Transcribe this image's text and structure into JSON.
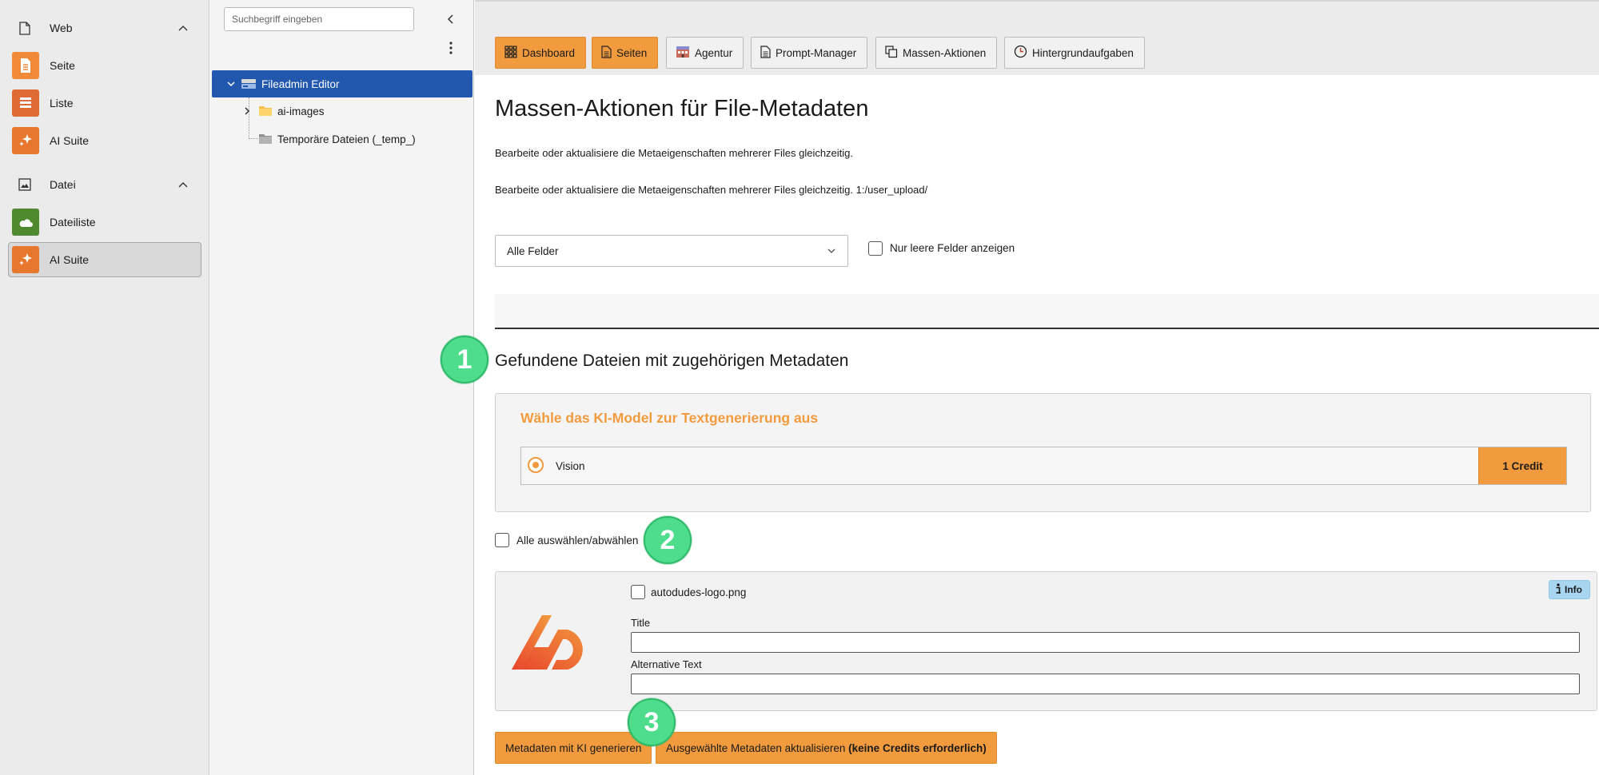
{
  "module_menu": {
    "groups": [
      {
        "label": "Web",
        "icon": "page-icon",
        "items": [
          {
            "label": "Seite",
            "icon": "page-icon",
            "color": "#f08a38"
          },
          {
            "label": "Liste",
            "icon": "list-icon",
            "color": "#e06a33"
          },
          {
            "label": "AI Suite",
            "icon": "sparkle-icon",
            "color": "#e8772e"
          }
        ]
      },
      {
        "label": "Datei",
        "icon": "image-icon",
        "items": [
          {
            "label": "Dateiliste",
            "icon": "cloud-file-icon",
            "color": "#4f8a2f"
          },
          {
            "label": "AI Suite",
            "icon": "sparkle-icon",
            "color": "#e8772e",
            "active": true
          }
        ]
      }
    ]
  },
  "tree": {
    "search_placeholder": "Suchbegriff eingeben",
    "root": {
      "label": "Fileadmin Editor",
      "icon": "storage-icon"
    },
    "children": [
      {
        "label": "ai-images",
        "icon": "folder-icon"
      },
      {
        "label": "Temporäre Dateien (_temp_)",
        "icon": "folder-grey-icon"
      }
    ]
  },
  "toolbar": {
    "buttons": [
      {
        "label": "Dashboard",
        "icon": "grid-icon",
        "active": true
      },
      {
        "label": "Seiten",
        "icon": "document-icon",
        "active": true
      },
      {
        "label": "Agentur",
        "icon": "building-icon",
        "active": false
      },
      {
        "label": "Prompt-Manager",
        "icon": "document-icon",
        "active": false
      },
      {
        "label": "Massen-Aktionen",
        "icon": "copy-icon",
        "active": false
      },
      {
        "label": "Hintergrundaufgaben",
        "icon": "clock-icon",
        "active": false
      }
    ]
  },
  "main": {
    "title": "Massen-Aktionen für File-Metadaten",
    "description_1": "Bearbeite oder aktualisiere die Metaeigenschaften mehrerer Files gleichzeitig.",
    "description_2": "Bearbeite oder aktualisiere die Metaeigenschaften mehrerer Files gleichzeitig. 1:/user_upload/",
    "field_select_value": "Alle Felder",
    "only_empty_label": "Nur leere Felder anzeigen",
    "found_title": "Gefundene Dateien mit zugehörigen Metadaten",
    "model_heading": "Wähle das KI-Model zur Textgenerierung aus",
    "model": {
      "name": "Vision",
      "credit": "1 Credit",
      "selected": true
    },
    "select_all_label": "Alle auswählen/abwählen",
    "file": {
      "name": "autodudes-logo.png",
      "info_label": "Info",
      "title_label": "Title",
      "title_value": "",
      "alt_label": "Alternative Text",
      "alt_value": ""
    },
    "generate_button": "Metadaten mit KI generieren",
    "update_button_text": "Ausgewählte Metadaten aktualisieren",
    "update_button_bold": "(keine Credits erforderlich)"
  },
  "step_badges": [
    "1",
    "2",
    "3"
  ],
  "colors": {
    "accent_orange": "#f29b3e",
    "tree_selected": "#2158ad",
    "step_badge": "#4edd8c",
    "info_badge": "#a8d6f0"
  }
}
